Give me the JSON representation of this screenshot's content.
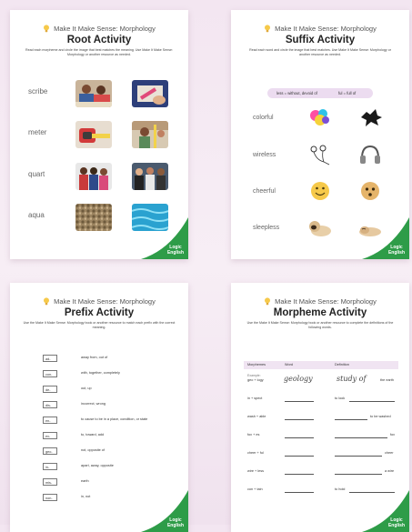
{
  "header": "Make It Make Sense: Morphology",
  "logo": {
    "line1": "Logic",
    "line2": "English"
  },
  "colors": {
    "brand_green": "#2e9c48",
    "pill": "#ecdcf0",
    "bulb": "#f6c94a"
  },
  "root": {
    "title": "Root Activity",
    "instructions": "Read each morpheme and circle the image that best matches the meaning. Use Make It Make Sense: Morphology or another resource as needed.",
    "rows": [
      {
        "word": "scribe",
        "images": [
          "writing-children-photo",
          "crayon-hand-photo"
        ]
      },
      {
        "word": "meter",
        "images": [
          "tape-measure-photo",
          "measuring-wall-photo"
        ]
      },
      {
        "word": "quart",
        "images": [
          "family-portrait-photo",
          "group-friends-photo"
        ]
      },
      {
        "word": "aqua",
        "images": [
          "gravel-texture-photo",
          "blue-water-photo"
        ]
      }
    ]
  },
  "suffix": {
    "title": "Suffix Activity",
    "instructions": "Read each word and circle the image that best matches. Use Make It Make Sense: Morphology or another resource as needed.",
    "key1": "less = without, devoid of",
    "key2": "ful = full of",
    "rows": [
      {
        "word": "colorful",
        "images": [
          "color-splash",
          "black-ink-splash"
        ]
      },
      {
        "word": "wireless",
        "images": [
          "wired-earbuds",
          "headphones"
        ]
      },
      {
        "word": "cheerful",
        "images": [
          "smiley-face",
          "neutral-face"
        ]
      },
      {
        "word": "sleepless",
        "images": [
          "awake-pug",
          "sleeping-puppy"
        ]
      }
    ]
  },
  "prefix": {
    "title": "Prefix Activity",
    "instructions": "Use the Make It Make Sense: Morphology book or another resource to match each prefix with the correct meaning.",
    "rows": [
      {
        "prefix": "ad-",
        "meaning": "away from, out of"
      },
      {
        "prefix": "con-",
        "meaning": "with, together, completely"
      },
      {
        "prefix": "de-",
        "meaning": "out, up"
      },
      {
        "prefix": "dis-",
        "meaning": "incorrect, wrong"
      },
      {
        "prefix": "en-",
        "meaning": "to cause to be in a place, condition, or state"
      },
      {
        "prefix": "ex-",
        "meaning": "to, toward, add"
      },
      {
        "prefix": "geo-",
        "meaning": "not, opposite of"
      },
      {
        "prefix": "in-",
        "meaning": "apart, away, opposite"
      },
      {
        "prefix": "mis-",
        "meaning": "earth"
      },
      {
        "prefix": "non-",
        "meaning": "in, not"
      }
    ]
  },
  "morpheme": {
    "title": "Morpheme Activity",
    "instructions": "Use the Make It Make Sense: Morphology book or another resource to complete the definitions of the following words.",
    "columns": [
      "Morphemes",
      "Word",
      "Definition"
    ],
    "example": {
      "label": "Example:",
      "morphemes": "geo + logy",
      "word": "geology",
      "def_hand": "study of",
      "def_post": "the earth"
    },
    "rows": [
      {
        "morphemes": "in + spect",
        "def_pre": "to look",
        "def_post": ""
      },
      {
        "morphemes": "wash + able",
        "def_pre": "",
        "def_post": "to be washed"
      },
      {
        "morphemes": "fox + es",
        "def_pre": "",
        "def_post": "fox"
      },
      {
        "morphemes": "cheer + ful",
        "def_pre": "",
        "def_post": "cheer"
      },
      {
        "morphemes": "wire + less",
        "def_pre": "",
        "def_post": "a wire"
      },
      {
        "morphemes": "con + tain",
        "def_pre": "to hold",
        "def_post": ""
      }
    ]
  }
}
